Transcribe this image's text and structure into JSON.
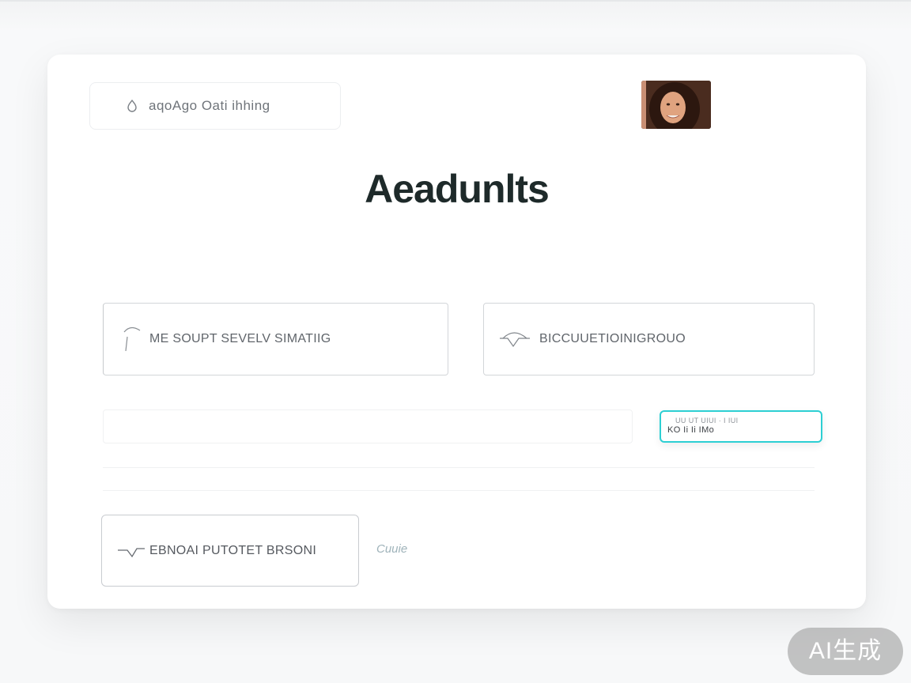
{
  "header": {
    "search_label": "aqoAgo Oati ihhing",
    "search_icon": "drop-icon",
    "avatar_icon": "user-avatar"
  },
  "main": {
    "title": "Aeadunlts",
    "options": [
      {
        "label": "ME SOUPT SEVELV SIMATIIG",
        "icon": "option-icon"
      },
      {
        "label": "BICCUUETIOINIGROUO",
        "icon": "option-icon"
      }
    ],
    "action_button": {
      "line1": "UU UT UIUI · I IUI",
      "line2": "KO Ii    Ii IMo"
    },
    "bottom_option": {
      "label": "EBNOAI PUTOTET BRSONI",
      "icon": "option-icon"
    },
    "side_link": "Cuuie"
  },
  "watermark": {
    "label": "AI生成"
  },
  "colors": {
    "accent": "#2dcfd3",
    "title": "#1e2a2a",
    "card": "#ffffff",
    "border": "#d3d6d9"
  }
}
